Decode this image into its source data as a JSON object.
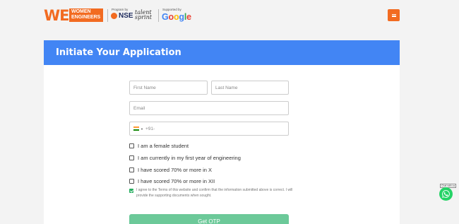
{
  "header": {
    "logo_we": "WE",
    "logo_women": "WOMEN",
    "logo_engineers": "ENGINEERS",
    "program_by_label": "Program by",
    "nse_label": "NSE",
    "talent_label": "talent",
    "sprint_label": "sprint",
    "supported_by_label": "Supported by",
    "google_letters": [
      "G",
      "o",
      "o",
      "g",
      "l",
      "e"
    ],
    "google_colors": [
      "#4285f4",
      "#ea4335",
      "#fbbc05",
      "#4285f4",
      "#34a853",
      "#ea4335"
    ],
    "accent": "#f26b21"
  },
  "menu": {
    "icon": "hamburger-icon"
  },
  "form": {
    "title": "Initiate Your Application",
    "header_color": "#4285f4",
    "first_name_placeholder": "First Name",
    "last_name_placeholder": "Last Name",
    "email_placeholder": "Email",
    "phone_prefix": "+91-",
    "country_flag": "india-flag-icon",
    "checkboxes": [
      {
        "label": "I am a female student",
        "checked": false
      },
      {
        "label": "I am currently in my first year of engineering",
        "checked": false
      },
      {
        "label": "I have scored 70% or more in X",
        "checked": false
      },
      {
        "label": "I have scored 70% or more in XII",
        "checked": false
      }
    ],
    "agree_text": "I agree to the Terms of this website and confirm that the information submitted above is correct. I will provide the supporting documents when sought.",
    "agree_checked": true,
    "otp_button": "Get OTP",
    "otp_button_color": "#6cc999"
  },
  "whatsapp": {
    "label": "Chat with us",
    "icon": "whatsapp-icon",
    "color": "#25d366"
  }
}
